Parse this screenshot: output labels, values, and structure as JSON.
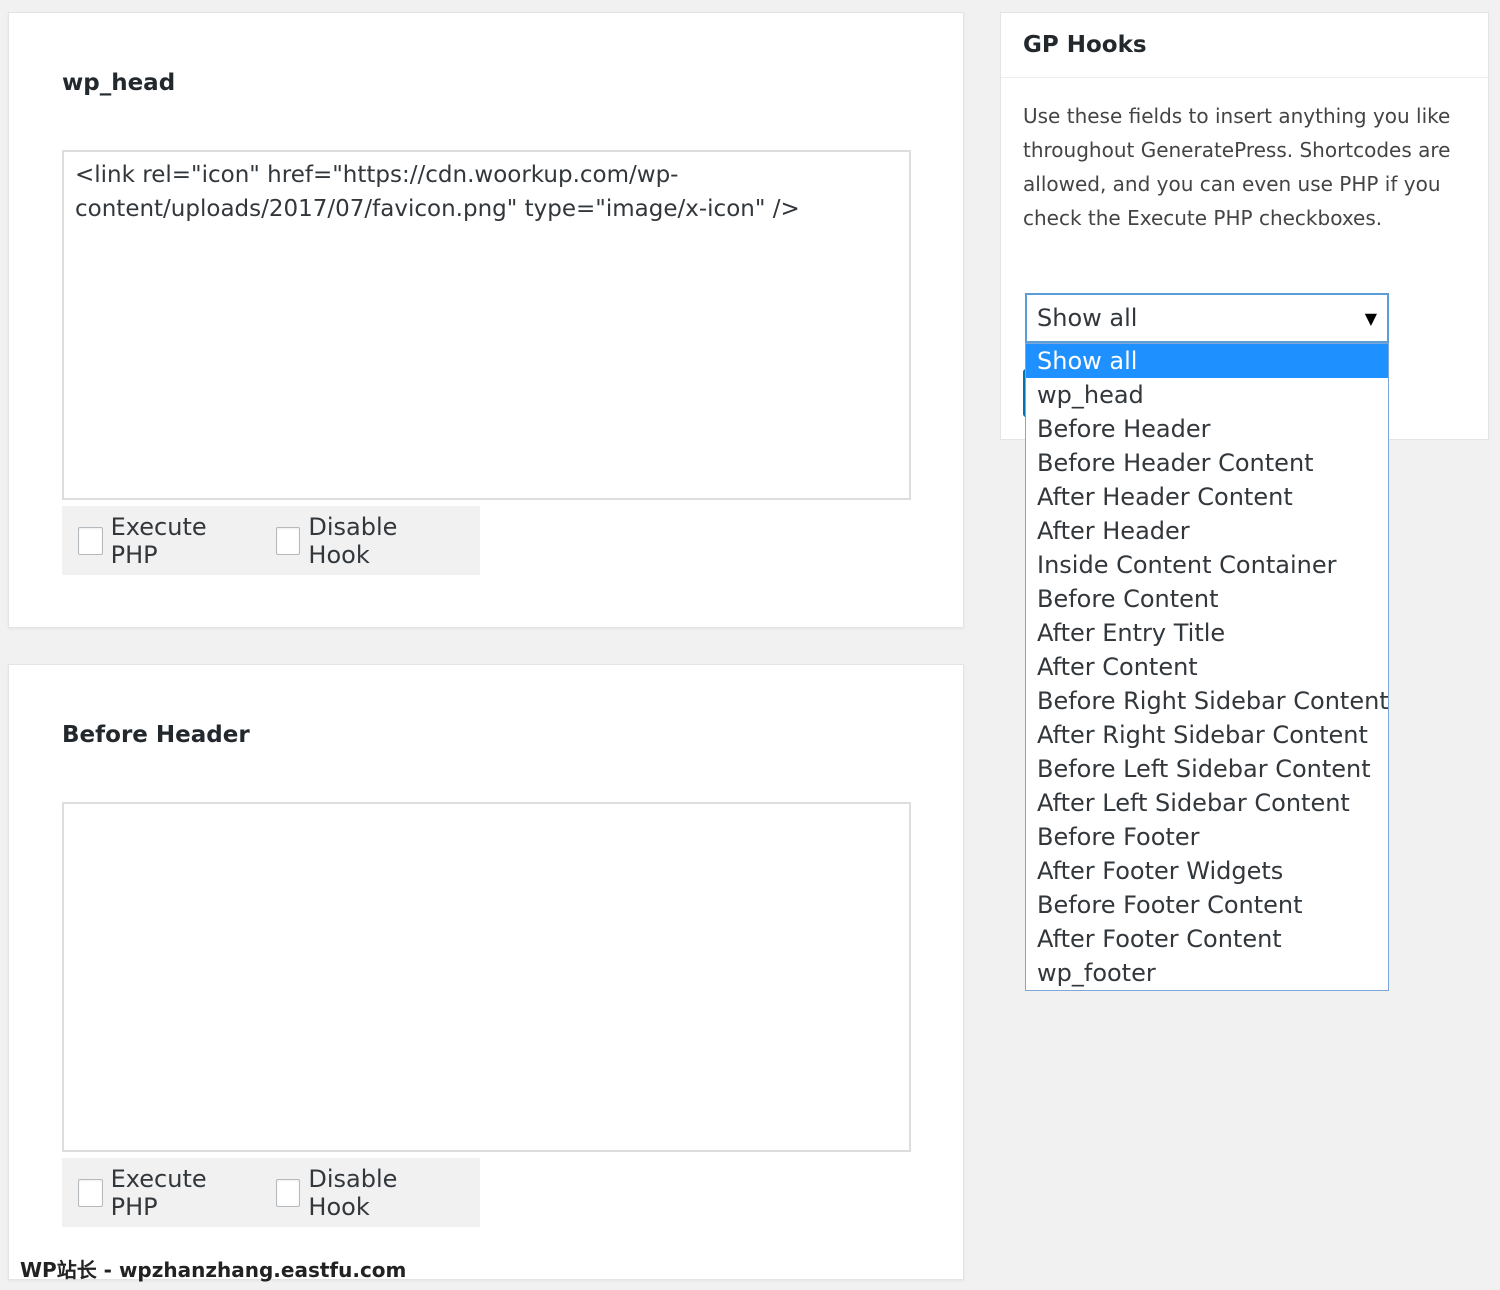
{
  "hooks": [
    {
      "title": "wp_head",
      "content": "<link rel=\"icon\" href=\"https://cdn.woorkup.com/wp-content/uploads/2017/07/favicon.png\" type=\"image/x-icon\" />",
      "execute_php_label": "Execute PHP",
      "disable_hook_label": "Disable Hook"
    },
    {
      "title": "Before Header",
      "content": "",
      "execute_php_label": "Execute PHP",
      "disable_hook_label": "Disable Hook"
    }
  ],
  "sidebar": {
    "title": "GP Hooks",
    "description": "Use these fields to insert anything you like throughout GeneratePress. Shortcodes are allowed, and you can even use PHP if you check the Execute PHP checkboxes."
  },
  "filter": {
    "selected": "Show all",
    "options": [
      "Show all",
      "wp_head",
      "Before Header",
      "Before Header Content",
      "After Header Content",
      "After Header",
      "Inside Content Container",
      "Before Content",
      "After Entry Title",
      "After Content",
      "Before Right Sidebar Content",
      "After Right Sidebar Content",
      "Before Left Sidebar Content",
      "After Left Sidebar Content",
      "Before Footer",
      "After Footer Widgets",
      "Before Footer Content",
      "After Footer Content",
      "wp_footer"
    ]
  },
  "watermark": "WP站长 - wpzhanzhang.eastfu.com",
  "colors": {
    "selected_option": "#1e90ff",
    "focus_border": "#5b9dd9",
    "background": "#f1f1f1"
  }
}
